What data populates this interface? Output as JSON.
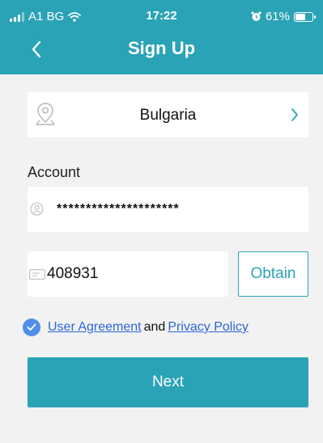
{
  "status_bar": {
    "carrier": "A1 BG",
    "time": "17:22",
    "battery": "61%",
    "battery_level": 0.61
  },
  "header": {
    "title": "Sign Up",
    "back_icon": "chevron-left-icon"
  },
  "country": {
    "name": "Bulgaria",
    "icon": "location-pin-icon"
  },
  "account": {
    "label": "Account",
    "value": "*********************"
  },
  "verification": {
    "code": "408931",
    "obtain_label": "Obtain"
  },
  "agreement": {
    "checked": true,
    "user_agreement": "User Agreement",
    "and": "and",
    "privacy_policy": "Privacy Policy"
  },
  "next_label": "Next",
  "colors": {
    "accent": "#2aa3b6",
    "link": "#2b66d9",
    "check": "#4f8fe6",
    "background": "#f2f2f2"
  }
}
